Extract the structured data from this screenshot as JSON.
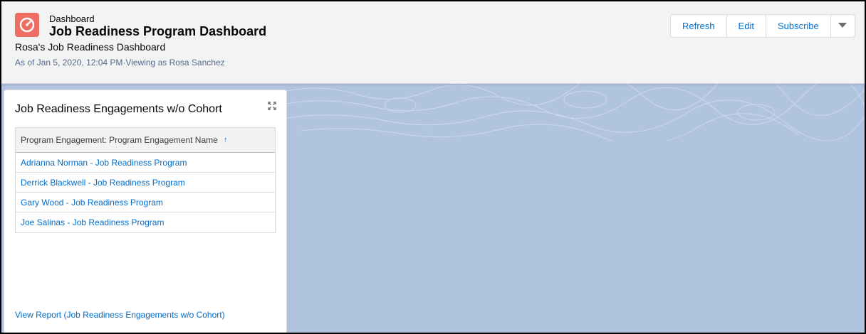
{
  "header": {
    "app_icon": "dashboard-gauge-icon",
    "icon_color": "#ef6e64",
    "eyebrow": "Dashboard",
    "title": "Job Readiness Program Dashboard",
    "subtitle": "Rosa's Job Readiness Dashboard",
    "meta": "As of Jan 5, 2020, 12:04 PM·Viewing as Rosa Sanchez",
    "buttons": {
      "refresh": "Refresh",
      "edit": "Edit",
      "subscribe": "Subscribe",
      "menu_icon": "chevron-down-icon"
    }
  },
  "widget": {
    "title": "Job Readiness Engagements w/o Cohort",
    "expand_icon": "expand-icon",
    "table": {
      "column": "Program Engagement: Program Engagement Name",
      "sort_icon": "arrow-up-icon",
      "rows": [
        "Adrianna Norman - Job Readiness Program",
        "Derrick Blackwell - Job Readiness Program",
        "Gary Wood - Job Readiness Program",
        "Joe Salinas - Job Readiness Program"
      ]
    },
    "footer_link": "View Report (Job Readiness Engagements w/o Cohort)"
  },
  "colors": {
    "link": "#006dcc",
    "background": "#b0c4df",
    "header_bg": "#f3f3f3"
  }
}
